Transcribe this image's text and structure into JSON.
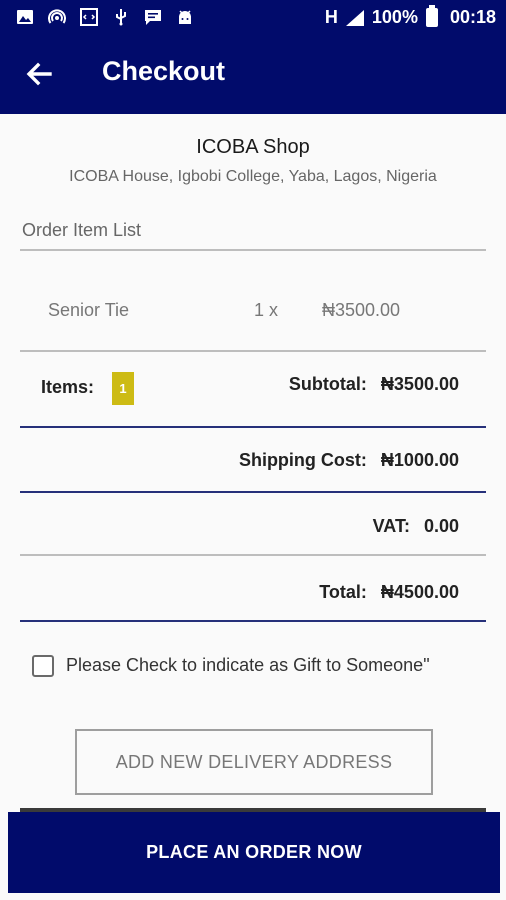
{
  "status_bar": {
    "icons": [
      "image-icon",
      "hotspot-icon",
      "code-icon",
      "usb-icon",
      "chat-icon",
      "android-icon"
    ],
    "network": "H",
    "battery": "100%",
    "time": "00:18"
  },
  "app_bar": {
    "title": "Checkout",
    "back_icon": "arrow-back-icon"
  },
  "shop": {
    "name": "ICOBA Shop",
    "address": "ICOBA House, Igbobi College, Yaba, Lagos, Nigeria"
  },
  "order": {
    "section_label": "Order Item List",
    "items": [
      {
        "name": "Senior Tie",
        "quantity": "1 x",
        "price": "₦3500.00"
      }
    ]
  },
  "summary": {
    "items_label": "Items:",
    "items_count": "1",
    "subtotal_label": "Subtotal:",
    "subtotal_value": "₦3500.00",
    "shipping_label": "Shipping Cost:",
    "shipping_value": "₦1000.00",
    "vat_label": "VAT:",
    "vat_value": "0.00",
    "total_label": "Total:",
    "total_value": "₦4500.00"
  },
  "gift": {
    "label": "Please Check to indicate as Gift to Someone\"",
    "checked": false
  },
  "buttons": {
    "add_address": "ADD NEW DELIVERY ADDRESS",
    "place_order": "PLACE AN ORDER NOW"
  },
  "colors": {
    "primary": "#010b6b",
    "badge": "#cdbb14"
  }
}
